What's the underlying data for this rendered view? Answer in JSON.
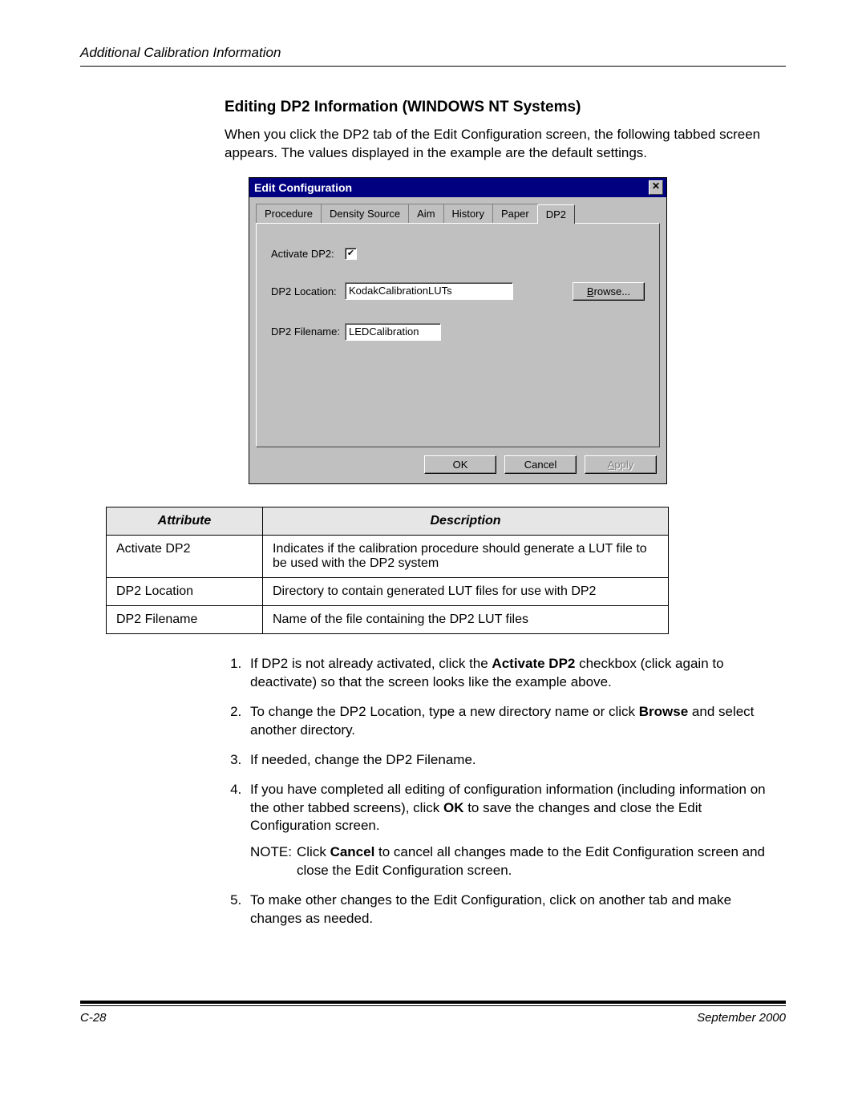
{
  "header": {
    "running_head": "Additional Calibration Information"
  },
  "section": {
    "title": "Editing DP2 Information (WINDOWS NT Systems)",
    "intro": "When you click the DP2 tab of the Edit Configuration screen, the following tabbed screen appears. The values displayed in the example are the default settings."
  },
  "dialog": {
    "title": "Edit Configuration",
    "close_glyph": "✕",
    "tabs": [
      "Procedure",
      "Density Source",
      "Aim",
      "History",
      "Paper",
      "DP2"
    ],
    "active_tab_index": 5,
    "fields": {
      "activate_label": "Activate DP2:",
      "activate_checked": "✔",
      "location_label": "DP2 Location:",
      "location_value": "KodakCalibrationLUTs",
      "filename_label": "DP2 Filename:",
      "filename_value": "LEDCalibration",
      "browse_pre": "B",
      "browse_rest": "rowse..."
    },
    "buttons": {
      "ok": "OK",
      "cancel": "Cancel",
      "apply_pre": "A",
      "apply_rest": "pply"
    }
  },
  "table": {
    "head_attr": "Attribute",
    "head_desc": "Description",
    "rows": [
      {
        "attr": "Activate DP2",
        "desc": "Indicates if the calibration procedure should generate a LUT file to be used with the DP2 system"
      },
      {
        "attr": "DP2 Location",
        "desc": "Directory to contain generated LUT files for use with DP2"
      },
      {
        "attr": "DP2 Filename",
        "desc": "Name of the file containing the DP2 LUT files"
      }
    ]
  },
  "steps": {
    "s1a": "If DP2 is not already activated, click the ",
    "s1b": "Activate DP2",
    "s1c": " checkbox (click again to deactivate) so that the screen looks like the example above.",
    "s2a": "To change the DP2 Location, type a new directory name or click ",
    "s2b": "Browse",
    "s2c": " and select another directory.",
    "s3": "If needed, change the DP2 Filename.",
    "s4a": "If you have completed all editing of configuration information (including information on the other tabbed screens), click ",
    "s4b": "OK",
    "s4c": " to save the changes and close the Edit Configuration screen.",
    "note_label": "NOTE:",
    "note_a": "Click ",
    "note_b": "Cancel",
    "note_c": " to cancel all changes made to the Edit Configuration screen and close the Edit Configuration screen.",
    "s5": "To make other changes to the Edit Configuration, click on another tab and make changes as needed."
  },
  "footer": {
    "page_num": "C-28",
    "date": "September 2000"
  }
}
